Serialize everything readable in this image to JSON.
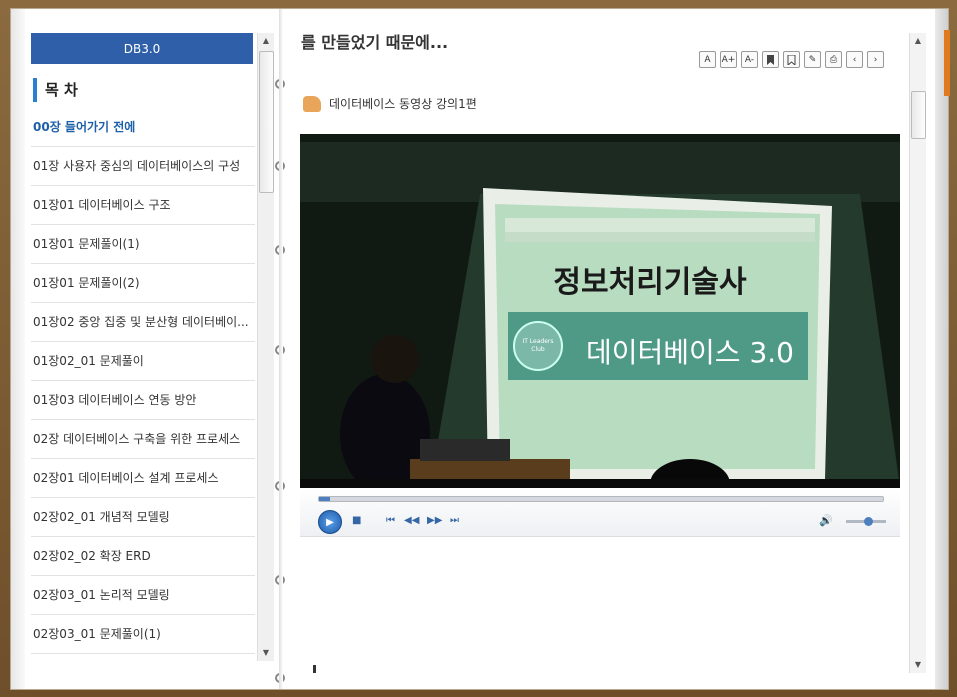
{
  "sidebar": {
    "header": "DB3.0",
    "toc_title": "목 차",
    "items": [
      {
        "label": "00장 들어가기 전에",
        "active": true
      },
      {
        "label": "01장 사용자 중심의 데이터베이스의 구성"
      },
      {
        "label": "01장01 데이터베이스 구조"
      },
      {
        "label": "01장01 문제풀이(1)"
      },
      {
        "label": "01장01 문제풀이(2)"
      },
      {
        "label": "01장02 중앙 집중 및 분산형 데이터베이..."
      },
      {
        "label": "01장02_01 문제풀이"
      },
      {
        "label": "01장03 데이터베이스 연동 방안"
      },
      {
        "label": "02장 데이터베이스 구축을 위한 프로세스"
      },
      {
        "label": "02장01 데이터베이스 설계 프로세스"
      },
      {
        "label": "02장02_01 개념적 모델링"
      },
      {
        "label": "02장02_02 확장 ERD"
      },
      {
        "label": "02장03_01 논리적 모델링"
      },
      {
        "label": "02장03_01 문제풀이(1)"
      }
    ]
  },
  "content": {
    "title": "를 만들었기 때문에...",
    "video_label": "데이터베이스 동영상 강의1편",
    "slide_title": "정보처리기술사",
    "slide_subtitle": "데이터베이스 3.0",
    "slide_logo": "IT Leaders Club"
  },
  "toolbar": {
    "buttons": [
      "font-reset-icon",
      "font-increase-icon",
      "font-decrease-icon",
      "bookmark-icon",
      "bookmark-list-icon",
      "memo-icon",
      "print-icon",
      "prev-icon",
      "next-icon"
    ]
  },
  "player": {
    "progress": 0.02,
    "volume": 0.55
  },
  "colors": {
    "header_blue": "#2f5fa8",
    "active_item": "#1d5fa8",
    "toc_accent": "#2b7fd0",
    "frame": "#7a5a32"
  }
}
